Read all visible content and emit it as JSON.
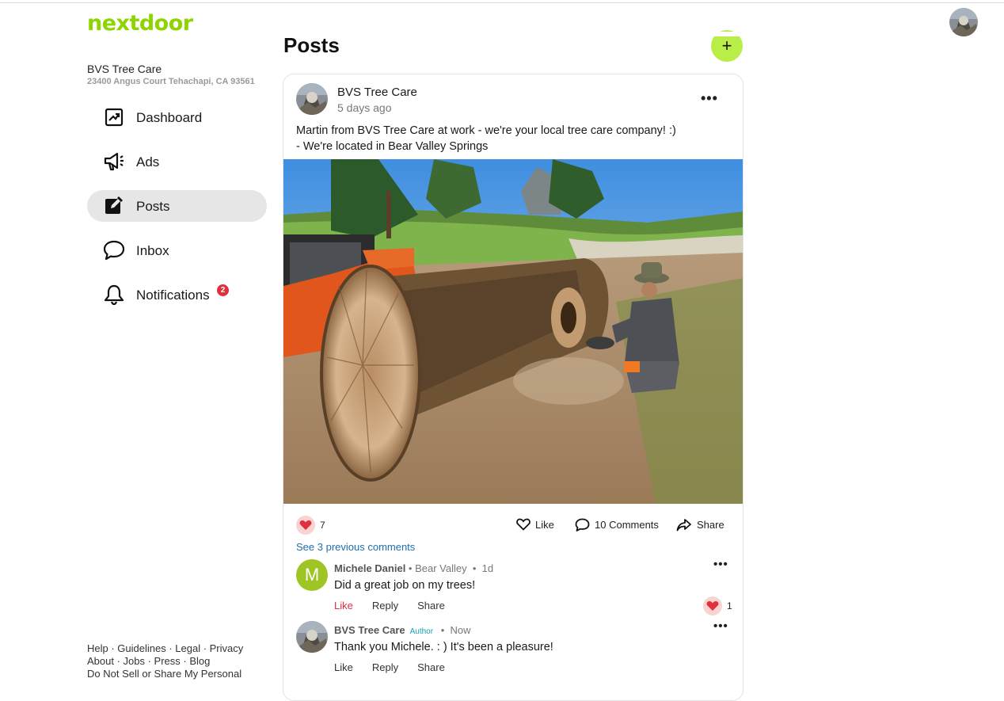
{
  "brand": {
    "logo_text": "nextdoor",
    "color": "#8ed500"
  },
  "business": {
    "name": "BVS Tree Care",
    "address": "23400 Angus Court Tehachapi, CA 93561"
  },
  "nav": {
    "dashboard": "Dashboard",
    "ads": "Ads",
    "posts": "Posts",
    "inbox": "Inbox",
    "notifications": "Notifications",
    "notifications_badge": "2",
    "active": "Posts"
  },
  "footer": {
    "line1": "Help · Guidelines · Legal · Privacy",
    "line2": "About · Jobs · Press · Blog",
    "line3": "Do Not Sell or Share My Personal"
  },
  "page": {
    "title": "Posts",
    "add_button": "+"
  },
  "post": {
    "author": "BVS Tree Care",
    "time": "5 days ago",
    "text_line1": "Martin from BVS Tree Care at work - we're your local tree care company! :)",
    "text_line2": "- We're located in Bear Valley Springs",
    "reaction_count": "7",
    "like_label": "Like",
    "comments_label": "10 Comments",
    "share_label": "Share",
    "see_previous": "See 3 previous comments"
  },
  "comments": [
    {
      "avatar_letter": "M",
      "author": "Michele Daniel",
      "neighborhood": "Bear Valley",
      "time": "1d",
      "text": "Did a great job on my trees!",
      "like": "Like",
      "reply": "Reply",
      "share": "Share",
      "reaction_count": "1"
    },
    {
      "author": "BVS Tree Care",
      "badge": "Author",
      "time": "Now",
      "text": "Thank you Michele. : ) It's been a pleasure!",
      "like": "Like",
      "reply": "Reply",
      "share": "Share"
    }
  ],
  "icons": {
    "dashboard": "chart-up-icon",
    "ads": "megaphone-icon",
    "posts": "edit-icon",
    "inbox": "chat-bubble-icon",
    "notifications": "bell-icon"
  }
}
